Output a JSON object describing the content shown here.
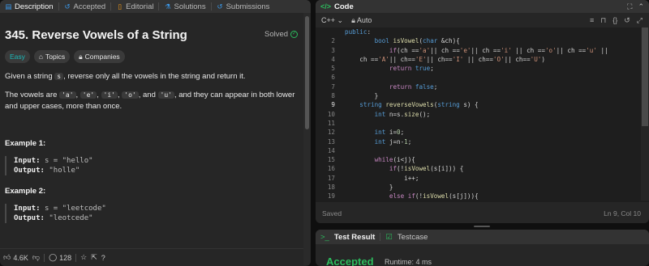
{
  "left_tabs": [
    {
      "label": "Description",
      "icon": "document-icon"
    },
    {
      "label": "Accepted",
      "icon": "history-icon"
    },
    {
      "label": "Editorial",
      "icon": "book-icon"
    },
    {
      "label": "Solutions",
      "icon": "flask-icon"
    },
    {
      "label": "Submissions",
      "icon": "history-icon"
    }
  ],
  "problem": {
    "title": "345. Reverse Vowels of a String",
    "status": "Solved",
    "difficulty": "Easy",
    "topics": "Topics",
    "companies": "Companies",
    "desc1_pre": "Given a string",
    "desc1_code": "s",
    "desc1_post": ", reverse only all the vowels in the string and return it.",
    "desc2_pre": "The vowels are",
    "vowels": [
      "'a'",
      "'e'",
      "'i'",
      "'o'",
      "'u'"
    ],
    "and": "and",
    "desc2_post": ", and they can appear in both lower and upper cases, more than once.",
    "examples": [
      {
        "heading": "Example 1:",
        "input_label": "Input:",
        "input": "s = \"hello\"",
        "output_label": "Output:",
        "output": "\"holle\""
      },
      {
        "heading": "Example 2:",
        "input_label": "Input:",
        "input": "s = \"leetcode\"",
        "output_label": "Output:",
        "output": "\"leotcede\""
      }
    ]
  },
  "bottom_bar": {
    "likes": "4.6K",
    "comments": "128"
  },
  "code_panel": {
    "title": "Code",
    "language": "C++",
    "mode": "Auto",
    "status": "Saved",
    "cursor": "Ln 9, Col 10"
  },
  "code_lines": [
    {
      "n": "",
      "t": "public:"
    },
    {
      "n": "2",
      "t": "        bool isVowel(char &ch){"
    },
    {
      "n": "3",
      "t": "            if(ch =='a'|| ch =='e'|| ch =='i' || ch =='o'|| ch =='u' ||"
    },
    {
      "n": "4",
      "t": "    ch =='A'|| ch=='E'|| ch=='I' || ch=='O'|| ch=='U')"
    },
    {
      "n": "5",
      "t": "            return true;"
    },
    {
      "n": "6",
      "t": ""
    },
    {
      "n": "7",
      "t": "            return false;"
    },
    {
      "n": "8",
      "t": "        }"
    },
    {
      "n": "9",
      "t": "    string reverseVowels(string s) {"
    },
    {
      "n": "10",
      "t": "        int n=s.size();"
    },
    {
      "n": "11",
      "t": ""
    },
    {
      "n": "12",
      "t": "        int i=0;"
    },
    {
      "n": "13",
      "t": "        int j=n-1;"
    },
    {
      "n": "14",
      "t": ""
    },
    {
      "n": "15",
      "t": "        while(i<j){"
    },
    {
      "n": "16",
      "t": "            if(!isVowel(s[i])) {"
    },
    {
      "n": "17",
      "t": "                i++;"
    },
    {
      "n": "18",
      "t": "            }"
    },
    {
      "n": "19",
      "t": "            else if(!isVowel(s[j])){"
    }
  ],
  "current_line": "9",
  "result_panel": {
    "tab1": "Test Result",
    "tab2": "Testcase",
    "verdict": "Accepted",
    "runtime": "Runtime: 4 ms"
  }
}
